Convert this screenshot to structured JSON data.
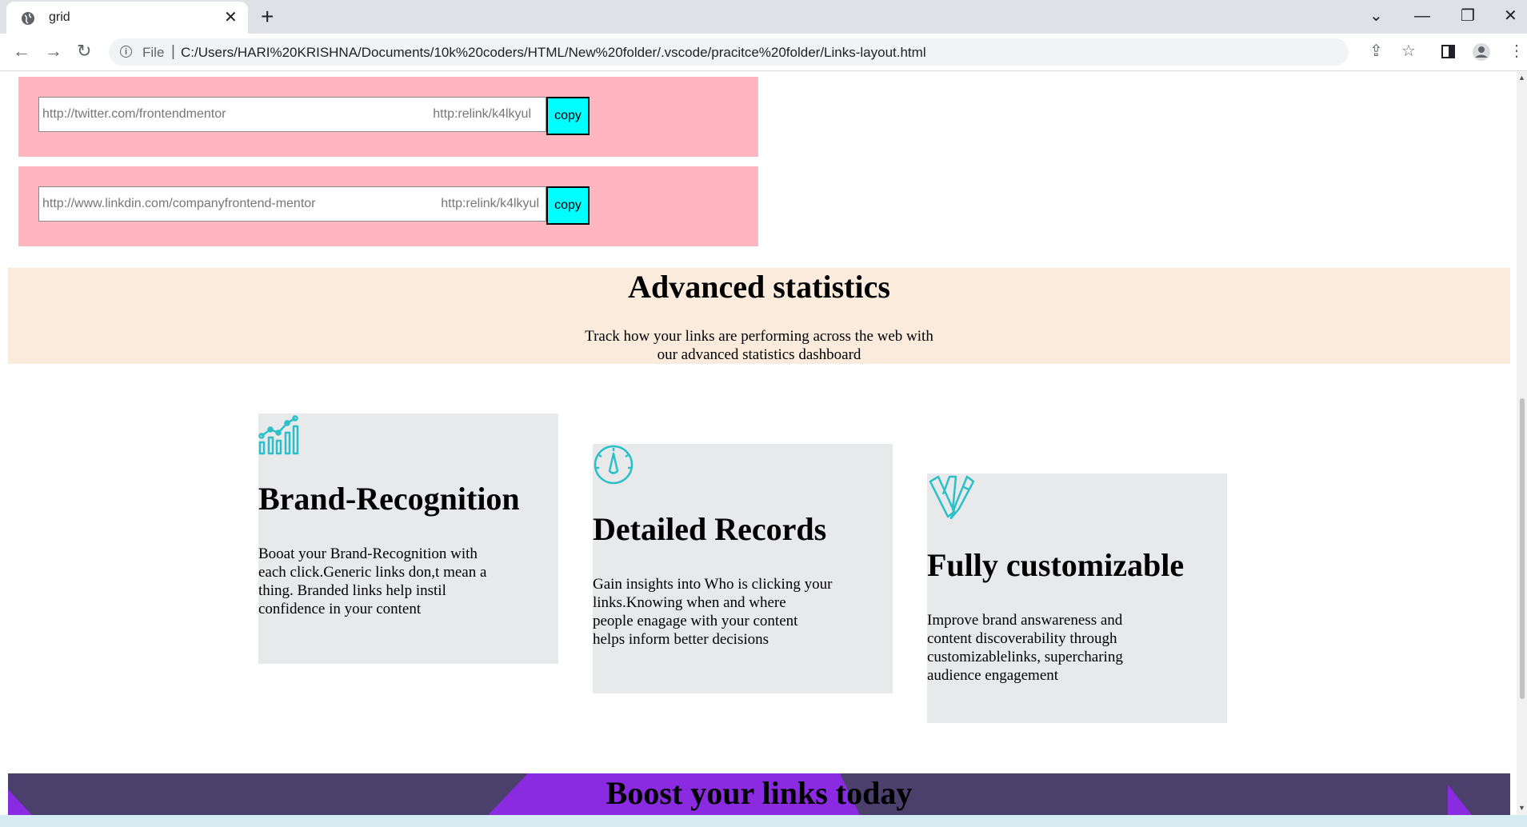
{
  "browser": {
    "tab_title": "grid",
    "tab_close": "✕",
    "new_tab": "+",
    "scheme": "File",
    "separator": "|",
    "url": "C:/Users/HARI%20KRISHNA/Documents/10k%20coders/HTML/New%20folder/.vscode/pracitce%20folder/Links-layout.html",
    "window_controls": [
      "⌄",
      "—",
      "❐",
      "✕"
    ]
  },
  "links": [
    {
      "original": "http://twitter.com/frontendmentor",
      "short": "http:relink/k4lkyul",
      "button": "copy"
    },
    {
      "original": "http://www.linkdin.com/companyfrontend-mentor",
      "short": "http:relink/k4lkyul",
      "button": "copy"
    }
  ],
  "stats": {
    "title": "Advanced statistics",
    "desc_line1": "Track how your links are performing across the web with",
    "desc_line2": "our advanced statistics dashboard"
  },
  "cards": [
    {
      "icon": "bar-chart-icon",
      "title": "Brand-Recognition",
      "lines": [
        "Booat your Brand-Recognition with",
        "each click.Generic links don,t mean a",
        "thing. Branded links help instil",
        "confidence in your content"
      ]
    },
    {
      "icon": "speedometer-icon",
      "title": "Detailed Records",
      "lines": [
        "Gain insights into Who is clicking your",
        "links.Knowing when and where",
        "people enagage with your content",
        "helps inform better decisions"
      ]
    },
    {
      "icon": "brush-pen-icon",
      "title": "Fully customizable",
      "lines": [
        "Improve brand answareness and",
        "content discoverability through",
        "customizablelinks, supercharing",
        "audience engagement"
      ]
    }
  ],
  "boost": {
    "title": "Boost your links today"
  },
  "colors": {
    "link_row_bg": "#ffb6c1",
    "copy_button": "#00ffff",
    "stats_bg": "#faebdd",
    "card_bg": "#e8e9eb",
    "icon_accent": "#2bc0c8",
    "boost_bg": "#4b3f6b",
    "boost_accent": "#8a2be2"
  }
}
